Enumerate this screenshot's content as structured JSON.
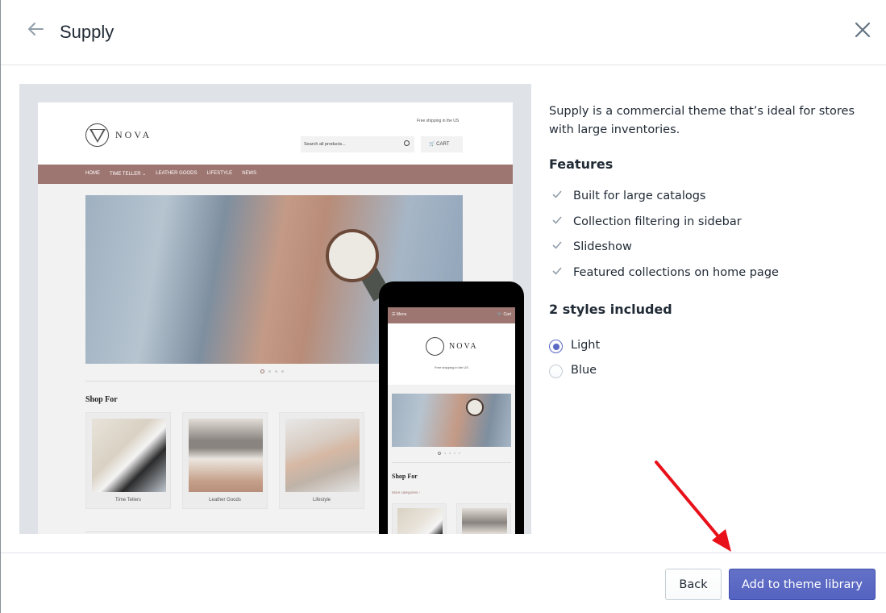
{
  "header": {
    "title": "Supply",
    "back_icon": "arrow-left-icon",
    "close_icon": "close-icon"
  },
  "preview": {
    "desktop": {
      "brand": "NOVA",
      "shipping": "Free shipping in the US",
      "search_placeholder": "Search all products...",
      "cart_label": "CART",
      "nav": [
        "HOME",
        "TIME TELLER ⌄",
        "LEATHER GOODS",
        "LIFESTYLE",
        "NEWS"
      ],
      "shop_for": "Shop For",
      "collections": [
        "Time Tellers",
        "Leather Goods",
        "Lifestyle"
      ],
      "slide_count": 4,
      "active_slide": 1,
      "accent_color": "#9e7671"
    },
    "mobile": {
      "menu_label": "☰  Menu",
      "cart_label": "Cart",
      "brand": "NOVA",
      "shipping": "Free shipping in the US",
      "shop_for": "Shop For",
      "more_categories": "More categories ›",
      "slide_count": 5,
      "active_slide": 1
    }
  },
  "info": {
    "description": "Supply is a commercial theme that’s ideal for stores with large inventories.",
    "features_heading": "Features",
    "features": [
      "Built for large catalogs",
      "Collection filtering in sidebar",
      "Slideshow",
      "Featured collections on home page"
    ],
    "styles_heading": "2 styles included",
    "styles": [
      {
        "label": "Light",
        "selected": true
      },
      {
        "label": "Blue",
        "selected": false
      }
    ]
  },
  "footer": {
    "back_label": "Back",
    "primary_label": "Add to theme library",
    "primary_color": "#5c6ac4"
  },
  "annotation": {
    "arrow_color": "#e8111a",
    "points_to": "Add to theme library"
  }
}
